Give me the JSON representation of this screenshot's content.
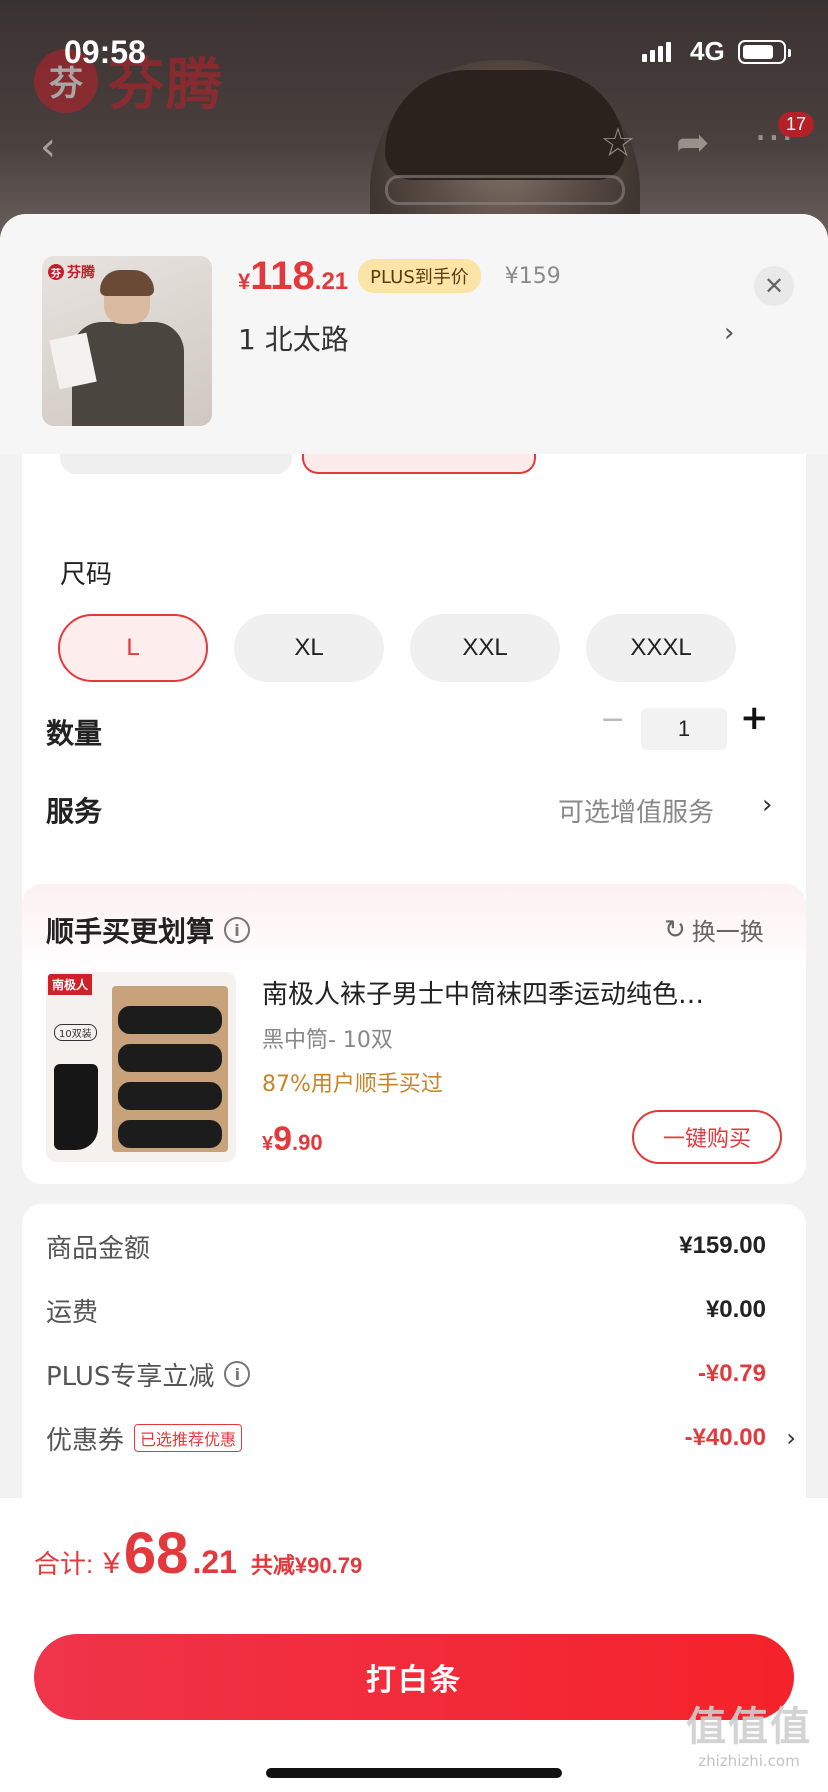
{
  "status_bar": {
    "time": "09:58",
    "network": "4G"
  },
  "background": {
    "brand_text": "芬腾",
    "cart_badge": "17"
  },
  "header": {
    "thumb_brand": "芬腾",
    "price_currency": "¥",
    "price_int": "118",
    "price_dec": ".21",
    "plus_tag": "PLUS到手价",
    "original_price": "¥159",
    "selected_spec": "1  北太路"
  },
  "spec": {
    "size_label": "尺码",
    "sizes": [
      "L",
      "XL",
      "XXL",
      "XXXL"
    ],
    "selected_size": "L",
    "qty_label": "数量",
    "qty_value": "1",
    "service_label": "服务",
    "service_value": "可选增值服务"
  },
  "recommend": {
    "title": "顺手买更划算",
    "refresh_label": "换一换",
    "product_name": "南极人袜子男士中筒袜四季运动纯色…",
    "variant": "黑中筒- 10双",
    "social_proof": "87%用户顺手买过",
    "price_currency": "¥",
    "price_int": "9",
    "price_dec": ".90",
    "buy_label": "一键购买",
    "img_brand": "南极人",
    "img_tag": "10双装"
  },
  "summary": {
    "rows": [
      {
        "label": "商品金额",
        "value": "¥159.00"
      },
      {
        "label": "运费",
        "value": "¥0.00"
      },
      {
        "label": "PLUS专享立减",
        "value": "-¥0.79"
      },
      {
        "label": "优惠券",
        "tag": "已选推荐优惠",
        "value": "-¥40.00"
      }
    ]
  },
  "footer": {
    "total_label": "合计:",
    "total_currency": "¥",
    "total_int": "68",
    "total_dec": ".21",
    "total_saving": "共减¥90.79",
    "pay_button": "打白条"
  },
  "watermark": {
    "glyph": "值值值",
    "url": "zhizhizhi.com"
  },
  "colors": {
    "accent": "#e4393c",
    "plus_tag_bg": "#fbe4a5",
    "social_proof": "#c8842a"
  }
}
